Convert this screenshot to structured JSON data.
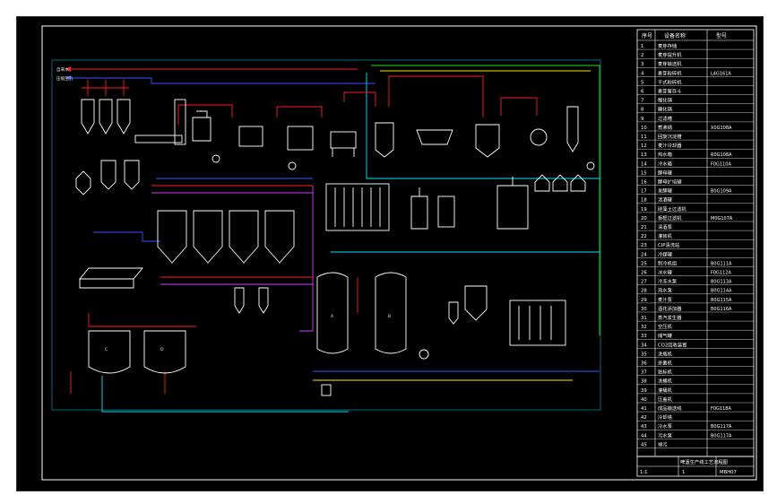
{
  "viewer": {
    "background": "#ffffff",
    "canvas": "#000000"
  },
  "colors": {
    "equipment": "#ffffff",
    "red_line": "#ff2020",
    "blue_line": "#2a5bff",
    "cyan_line": "#00e5ff",
    "green_line": "#21e021",
    "yellow_line": "#f0f000",
    "magenta_line": "#d43cff",
    "orange_line": "#ff9a20",
    "frame": "#ffffff"
  },
  "drawing": {
    "left_labels": [
      "自来水",
      "压缩空气"
    ],
    "tank_labels": [
      "A",
      "B",
      "C",
      "D"
    ]
  },
  "legend": {
    "headers": [
      "序号",
      "设备名称",
      "型号"
    ],
    "rows": [
      {
        "no": "1",
        "name": "麦芽存储",
        "code": ""
      },
      {
        "no": "2",
        "name": "麦芽提升机",
        "code": ""
      },
      {
        "no": "3",
        "name": "麦芽输送机",
        "code": ""
      },
      {
        "no": "4",
        "name": "麦芽粉碎机",
        "code": "L4G161A"
      },
      {
        "no": "5",
        "name": "干式粉碎机",
        "code": ""
      },
      {
        "no": "6",
        "name": "麦芽暂存斗",
        "code": ""
      },
      {
        "no": "7",
        "name": "糊化锅",
        "code": ""
      },
      {
        "no": "8",
        "name": "糖化锅",
        "code": ""
      },
      {
        "no": "9",
        "name": "过滤槽",
        "code": ""
      },
      {
        "no": "10",
        "name": "煮沸锅",
        "code": "X0G108A"
      },
      {
        "no": "11",
        "name": "回旋沉淀槽",
        "code": ""
      },
      {
        "no": "12",
        "name": "麦汁冷却器",
        "code": ""
      },
      {
        "no": "13",
        "name": "热水箱",
        "code": "R0G108A"
      },
      {
        "no": "14",
        "name": "冷水箱",
        "code": "F0G110A"
      },
      {
        "no": "15",
        "name": "酵母罐",
        "code": ""
      },
      {
        "no": "16",
        "name": "酵母扩培罐",
        "code": ""
      },
      {
        "no": "17",
        "name": "发酵罐",
        "code": "B0G109A"
      },
      {
        "no": "18",
        "name": "清酒罐",
        "code": ""
      },
      {
        "no": "19",
        "name": "硅藻土过滤机",
        "code": ""
      },
      {
        "no": "20",
        "name": "板框过滤机",
        "code": "M0G107A"
      },
      {
        "no": "21",
        "name": "清酒泵",
        "code": ""
      },
      {
        "no": "22",
        "name": "灌装机",
        "code": ""
      },
      {
        "no": "23",
        "name": "CIP清洗站",
        "code": ""
      },
      {
        "no": "24",
        "name": "冷媒罐",
        "code": ""
      },
      {
        "no": "25",
        "name": "制冷机组",
        "code": "B0G111A"
      },
      {
        "no": "26",
        "name": "冰水罐",
        "code": "F0G112A"
      },
      {
        "no": "27",
        "name": "冷冻水泵",
        "code": "B0G113A"
      },
      {
        "no": "28",
        "name": "热水泵",
        "code": "B0G114A"
      },
      {
        "no": "29",
        "name": "麦汁泵",
        "code": "B0G115A"
      },
      {
        "no": "30",
        "name": "酒花添加器",
        "code": "B0G116A"
      },
      {
        "no": "31",
        "name": "蒸汽发生器",
        "code": ""
      },
      {
        "no": "32",
        "name": "空压机",
        "code": ""
      },
      {
        "no": "33",
        "name": "储气罐",
        "code": ""
      },
      {
        "no": "34",
        "name": "CO2回收装置",
        "code": ""
      },
      {
        "no": "35",
        "name": "洗瓶机",
        "code": ""
      },
      {
        "no": "36",
        "name": "杀菌机",
        "code": ""
      },
      {
        "no": "37",
        "name": "贴标机",
        "code": ""
      },
      {
        "no": "38",
        "name": "洗桶机",
        "code": ""
      },
      {
        "no": "39",
        "name": "灌桶机",
        "code": ""
      },
      {
        "no": "40",
        "name": "压盖机",
        "code": ""
      },
      {
        "no": "41",
        "name": "成品输送线",
        "code": "F0G118A"
      },
      {
        "no": "42",
        "name": "冷却塔",
        "code": ""
      },
      {
        "no": "43",
        "name": "冷水泵",
        "code": "B0G117A"
      },
      {
        "no": "44",
        "name": "污水泵",
        "code": "B0G117A"
      },
      {
        "no": "45",
        "name": "排污",
        "code": ""
      }
    ]
  },
  "title_block": {
    "project": "啤酒生产线工艺流程图",
    "scale": "1:1",
    "sheet": "1",
    "drawing_no": "MBH07"
  }
}
